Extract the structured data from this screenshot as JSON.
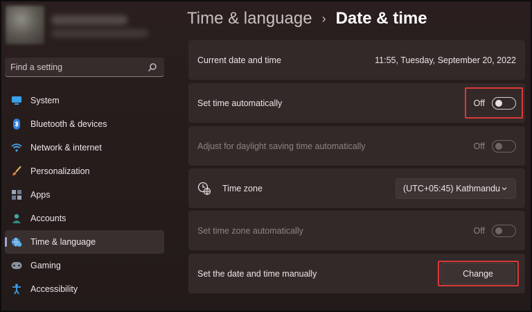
{
  "sidebar": {
    "search_placeholder": "Find a setting",
    "items": [
      {
        "label": "System",
        "icon": "system-icon"
      },
      {
        "label": "Bluetooth & devices",
        "icon": "bluetooth-icon"
      },
      {
        "label": "Network & internet",
        "icon": "wifi-icon"
      },
      {
        "label": "Personalization",
        "icon": "brush-icon"
      },
      {
        "label": "Apps",
        "icon": "apps-icon"
      },
      {
        "label": "Accounts",
        "icon": "accounts-icon"
      },
      {
        "label": "Time & language",
        "icon": "globe-clock-icon",
        "active": true
      },
      {
        "label": "Gaming",
        "icon": "gamepad-icon"
      },
      {
        "label": "Accessibility",
        "icon": "accessibility-icon"
      }
    ]
  },
  "header": {
    "parent": "Time & language",
    "separator": "›",
    "current": "Date & time"
  },
  "settings": {
    "current": {
      "label": "Current date and time",
      "value": "11:55, Tuesday, September 20, 2022"
    },
    "auto_time": {
      "label": "Set time automatically",
      "state": "Off"
    },
    "daylight": {
      "label": "Adjust for daylight saving time automatically",
      "state": "Off"
    },
    "timezone": {
      "label": "Time zone",
      "value": "(UTC+05:45) Kathmandu"
    },
    "auto_timezone": {
      "label": "Set time zone automatically",
      "state": "Off"
    },
    "manual": {
      "label": "Set the date and time manually",
      "button": "Change"
    }
  },
  "colors": {
    "background": "#241a1a",
    "card": "#342929",
    "highlight": "#d93a3a",
    "accent": "#9fa7d8"
  }
}
